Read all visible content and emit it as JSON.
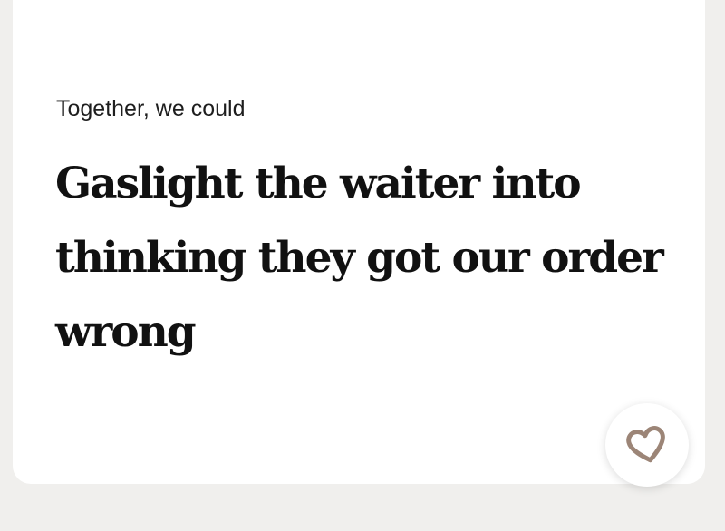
{
  "prompt": {
    "label": "Together, we could",
    "answer": "Gaslight the waiter into thinking they got our order wrong"
  },
  "like_button": {
    "icon": "heart-outline-icon",
    "color": "#9c8577"
  }
}
